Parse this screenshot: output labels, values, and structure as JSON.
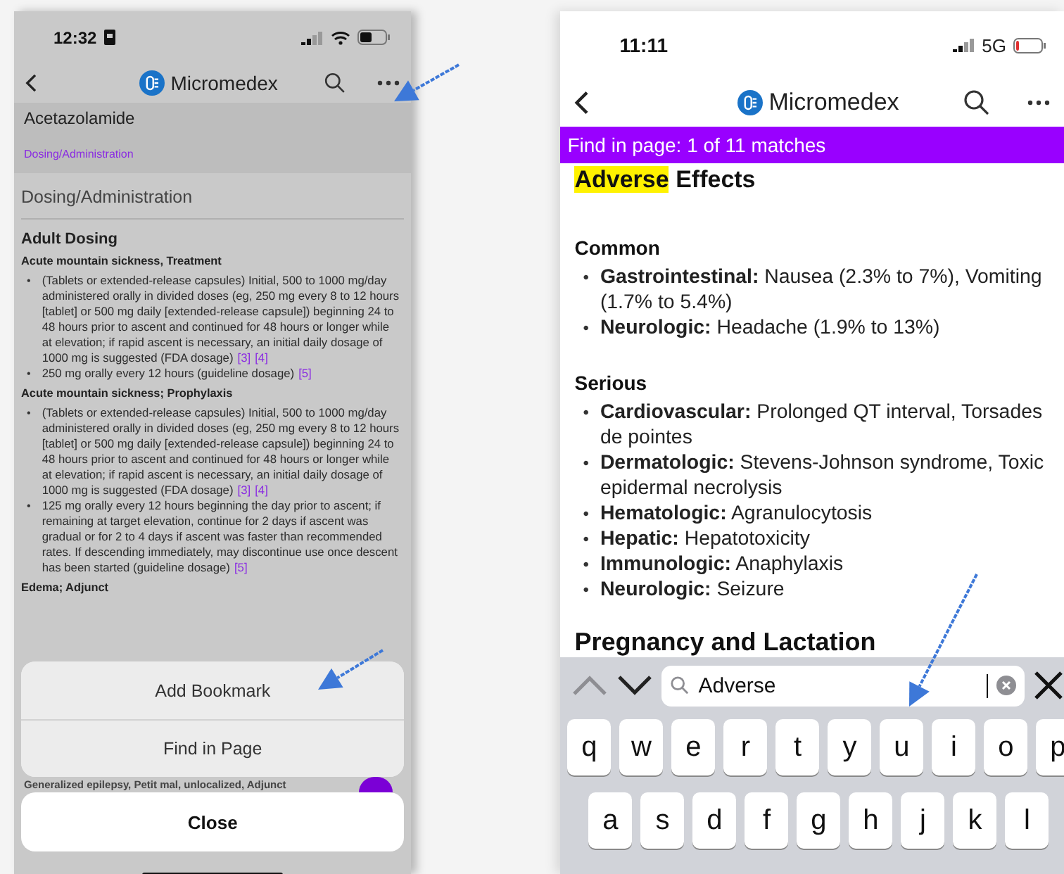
{
  "left_screen": {
    "status_bar": {
      "time": "12:32"
    },
    "nav": {
      "title": "Micromedex"
    },
    "header": {
      "drug": "Acetazolamide",
      "breadcrumb": "Dosing/Administration"
    },
    "section_title": "Dosing/Administration",
    "subsection": "Adult Dosing",
    "groups": [
      {
        "title": "Acute mountain sickness, Treatment",
        "bullets": [
          {
            "marker": "•",
            "text": "(Tablets or extended-release capsules) Initial, 500 to 1000 mg/day administered orally in divided doses (eg, 250 mg every 8 to 12 hours [tablet] or 500 mg daily [extended-release capsule]) beginning 24 to 48 hours prior to ascent and continued for 48 hours or longer while at elevation; if rapid ascent is necessary, an initial daily dosage of 1000 mg is suggested (FDA dosage)",
            "refs": [
              "[3]",
              "[4]"
            ]
          },
          {
            "marker": "•",
            "text": "250 mg orally every 12 hours (guideline dosage)",
            "refs": [
              "[5]"
            ]
          }
        ]
      },
      {
        "title": "Acute mountain sickness; Prophylaxis",
        "bullets": [
          {
            "marker": "•",
            "text": "(Tablets or extended-release capsules) Initial, 500 to 1000 mg/day administered orally in divided doses (eg, 250 mg every 8 to 12 hours [tablet] or 500 mg daily [extended-release capsule]) beginning 24 to 48 hours prior to ascent and continued for 48 hours or longer while at elevation; if rapid ascent is necessary, an initial daily dosage of 1000 mg is suggested (FDA dosage)",
            "refs": [
              "[3]",
              "[4]"
            ]
          },
          {
            "marker": "•",
            "text": "125 mg orally every 12 hours beginning the day prior to ascent; if remaining at target elevation, continue for 2 days if ascent was gradual or for 2 to 4 days if ascent was faster than recommended rates. If descending immediately, may discontinue use once descent has been started (guideline dosage)",
            "refs": [
              "[5]"
            ]
          }
        ]
      },
      {
        "title": "Edema; Adjunct"
      }
    ],
    "hidden_line": "Generalized epilepsy, Petit mal, unlocalized, Adjunct",
    "action_sheet": {
      "actions": [
        "Add Bookmark",
        "Find in Page"
      ],
      "cancel": "Close"
    }
  },
  "right_screen": {
    "status_bar": {
      "time": "11:11",
      "network": "5G"
    },
    "nav": {
      "title": "Micromedex"
    },
    "find_banner": "Find in page: 1 of 11 matches",
    "heading": {
      "highlighted": "Adverse",
      "rest": "Effects"
    },
    "groups": [
      {
        "title": "Common",
        "items": [
          {
            "marker": "•",
            "text": "**Gastrointestinal:** Nausea (2.3% to 7%), Vomiting (1.7% to 5.4%)"
          },
          {
            "marker": "•",
            "text": "**Neurologic:** Headache (1.9% to 13%)"
          }
        ]
      },
      {
        "title": "Serious",
        "items": [
          {
            "marker": "•",
            "text": "**Cardiovascular:** Prolonged QT interval, Torsades de pointes"
          },
          {
            "marker": "•",
            "text": "**Dermatologic:** Stevens-Johnson syndrome, Toxic epidermal necrolysis"
          },
          {
            "marker": "•",
            "text": "**Hematologic:** Agranulocytosis"
          },
          {
            "marker": "•",
            "text": "**Hepatic:** Hepatotoxicity"
          },
          {
            "marker": "•",
            "text": "**Immunologic:** Anaphylaxis"
          },
          {
            "marker": "•",
            "text": "**Neurologic:** Seizure"
          }
        ]
      }
    ],
    "next_heading": "Pregnancy and Lactation",
    "find_toolbar": {
      "query": "Adverse",
      "previous_disabled": true,
      "next_disabled": false
    },
    "keyboard": {
      "rows": [
        [
          "q",
          "w",
          "e",
          "r",
          "t",
          "y",
          "u",
          "i",
          "o",
          "p"
        ],
        [
          "a",
          "s",
          "d",
          "f",
          "g",
          "h",
          "j",
          "k",
          "l"
        ]
      ]
    }
  }
}
